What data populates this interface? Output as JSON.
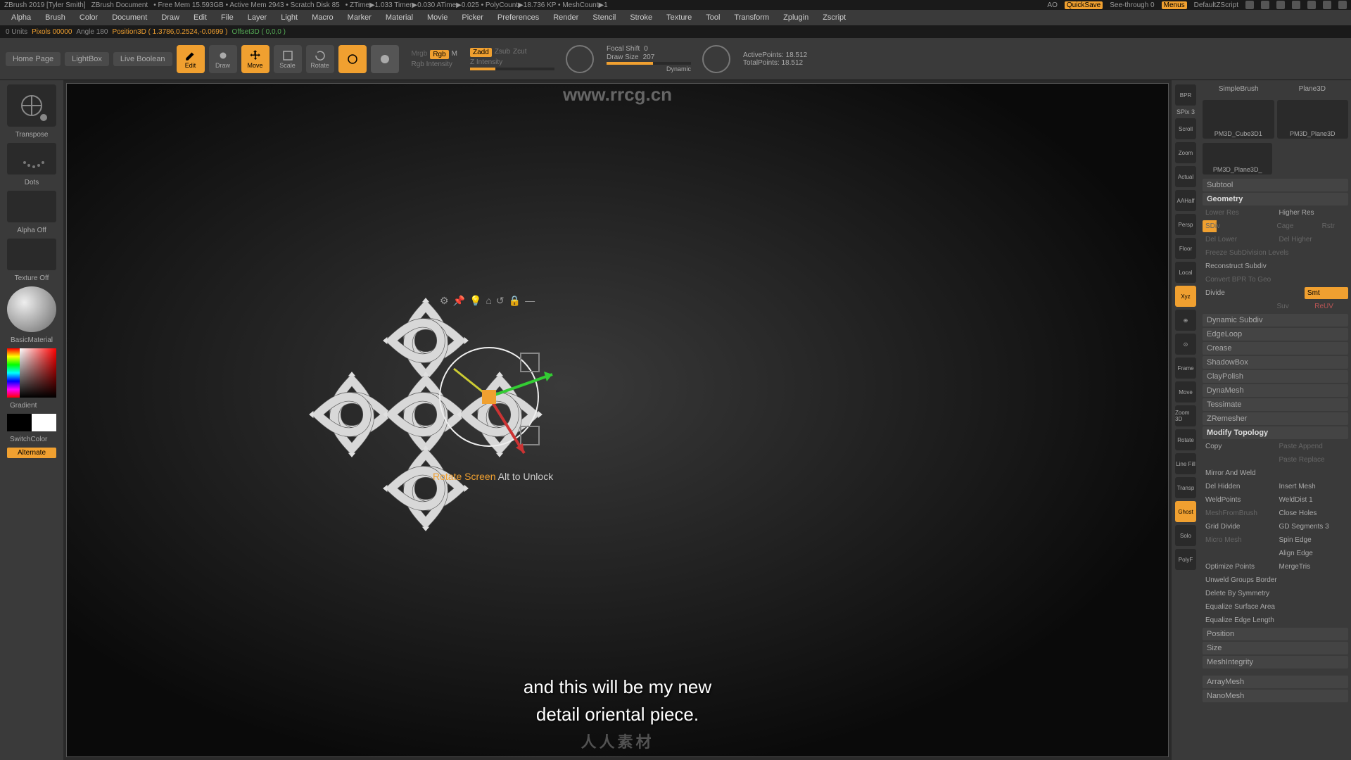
{
  "title_bar": {
    "app": "ZBrush 2019 [Tyler Smith]",
    "doc": "ZBrush Document",
    "mem": "• Free Mem 15.593GB • Active Mem 2943 • Scratch Disk 85",
    "timer": "• ZTime▶1.033 Timer▶0.030 ATime▶0.025 • PolyCount▶18.736 KP • MeshCount▶1",
    "ao": "AO",
    "quicksave": "QuickSave",
    "seethrough": "See-through 0",
    "menus": "Menus",
    "zscript": "DefaultZScript"
  },
  "menu_bar": [
    "Alpha",
    "Brush",
    "Color",
    "Document",
    "Draw",
    "Edit",
    "File",
    "Layer",
    "Light",
    "Macro",
    "Marker",
    "Material",
    "Movie",
    "Picker",
    "Preferences",
    "Render",
    "Stencil",
    "Stroke",
    "Texture",
    "Tool",
    "Transform",
    "Zplugin",
    "Zscript"
  ],
  "info_bar": {
    "units": "0 Units",
    "pixols": "Pixols 00000",
    "angle": "Angle 180",
    "pos": "Position3D ( 1.3786,0.2524,-0.0699 )",
    "offset": "Offset3D ( 0,0,0 )"
  },
  "toolbar": {
    "home": "Home Page",
    "lightbox": "LightBox",
    "liveboolean": "Live Boolean",
    "edit": "Edit",
    "draw": "Draw",
    "move": "Move",
    "scale": "Scale",
    "rotate": "Rotate",
    "mrgb": "Mrgb",
    "rgb": "Rgb",
    "m": "M",
    "rgb_intensity": "Rgb Intensity",
    "zadd": "Zadd",
    "zsub": "Zsub",
    "zcut": "Zcut",
    "z_intensity": "Z Intensity",
    "focal_label": "Focal Shift",
    "focal_val": "0",
    "draw_label": "Draw Size",
    "draw_val": "207",
    "dynamic": "Dynamic",
    "active_label": "ActivePoints:",
    "active_val": "18.512",
    "total_label": "TotalPoints:",
    "total_val": "18.512"
  },
  "left_panel": {
    "transpose": "Transpose",
    "dots": "Dots",
    "alpha_off": "Alpha Off",
    "texture_off": "Texture Off",
    "basic_material": "BasicMaterial",
    "gradient": "Gradient",
    "switchcolor": "SwitchColor",
    "alternate": "Alternate"
  },
  "viewport": {
    "watermark_top": "www.rrcg.cn",
    "caption1": "and this will be my new",
    "caption2": "detail oriental piece.",
    "watermark_bot": "人人素材",
    "gizmo_hint_a": "Rotate Screen",
    "gizmo_hint_b": " Alt to Unlock"
  },
  "right_icons": {
    "bpr": "BPR",
    "spix": "SPix 3",
    "scroll": "Scroll",
    "zoom": "Zoom",
    "actual": "Actual",
    "aahalf": "AAHalf",
    "persp": "Persp",
    "floor": "Floor",
    "local": "Local",
    "xyz": "Xyz",
    "frame": "Frame",
    "move": "Move",
    "zoom3d": "Zoom 3D",
    "rotate": "Rotate",
    "linefill": "Line Fill",
    "transp": "Transp",
    "ghost": "Ghost",
    "solo": "Solo",
    "pf": "PolyF"
  },
  "right_panel": {
    "brush_a": "SimpleBrush",
    "brush_b": "Plane3D",
    "thumb_a": "PM3D_Cube3D1",
    "thumb_b": "PM3D_Plane3D",
    "thumb_c": "PM3D_Plane3D_",
    "subtool": "Subtool",
    "geometry": "Geometry",
    "lower_res": "Lower Res",
    "higher_res": "Higher Res",
    "sdiv": "SDiv",
    "cage": "Cage",
    "rstr": "Rstr",
    "del_lower": "Del Lower",
    "del_higher": "Del Higher",
    "freeze_sub": "Freeze SubDivision Levels",
    "reconstruct": "Reconstruct Subdiv",
    "convert_bpr": "Convert BPR To Geo",
    "divide": "Divide",
    "smt": "Smt",
    "suv": "Suv",
    "reuv": "ReUV",
    "dynamic_subdiv": "Dynamic Subdiv",
    "edgeloop": "EdgeLoop",
    "crease": "Crease",
    "shadowbox": "ShadowBox",
    "claypolish": "ClayPolish",
    "dynamesh": "DynaMesh",
    "tessimate": "Tessimate",
    "zremesher": "ZRemesher",
    "modify_topology": "Modify Topology",
    "copy": "Copy",
    "paste_append": "Paste Append",
    "paste_replace": "Paste Replace",
    "mirror_weld": "Mirror And Weld",
    "del_hidden": "Del Hidden",
    "insert_mesh": "Insert Mesh",
    "weldpoints": "WeldPoints",
    "welddist": "WeldDist 1",
    "meshfrombrush": "MeshFromBrush",
    "close_holes": "Close Holes",
    "grid_divide": "Grid Divide",
    "gd_segments": "GD Segments 3",
    "micro_mesh": "Micro Mesh",
    "spin_edge": "Spin Edge",
    "align_edge": "Align Edge",
    "optimize_pts": "Optimize Points",
    "mergetris": "MergeTris",
    "unweld_border": "Unweld Groups Border",
    "delete_sym": "Delete By Symmetry",
    "equalize_area": "Equalize Surface Area",
    "equalize_edge": "Equalize Edge Length",
    "position": "Position",
    "size": "Size",
    "meshintegrity": "MeshIntegrity",
    "arraymesh": "ArrayMesh",
    "nanomesh": "NanoMesh"
  }
}
